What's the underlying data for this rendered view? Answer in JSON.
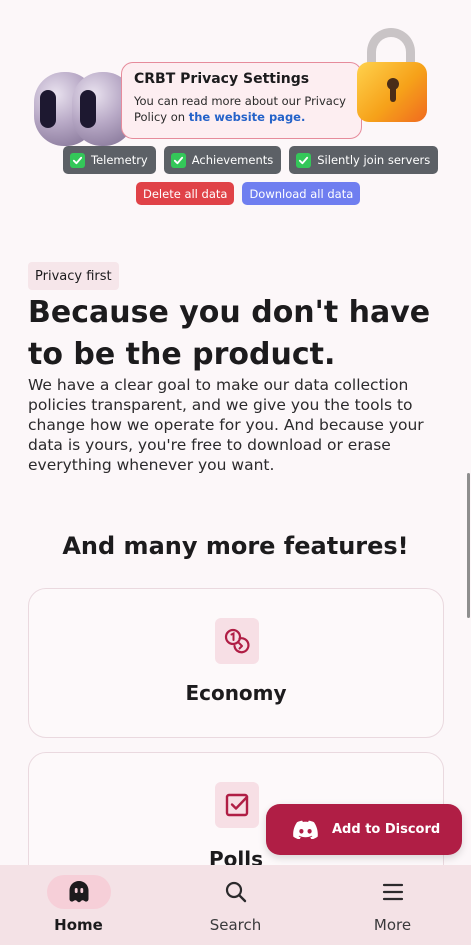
{
  "hero": {
    "card_title": "CRBT Privacy Settings",
    "card_text": "You can read more about our Privacy Policy on",
    "card_link": "the website page.",
    "chips": [
      "Telemetry",
      "Achievements",
      "Silently join servers"
    ],
    "delete_label": "Delete all data",
    "download_label": "Download all data"
  },
  "privacy": {
    "tag": "Privacy first",
    "headline": "Because you don't have to be the product.",
    "paragraph": "We have a clear goal to make our data collection policies transparent, and we give you the tools to change how we operate for you. And because your data is yours, you're free to download or erase everything whenever you want."
  },
  "features": {
    "title": "And many more features!",
    "items": [
      {
        "label": "Economy",
        "icon": "coins-icon"
      },
      {
        "label": "Polls",
        "icon": "checkbox-icon"
      }
    ]
  },
  "discord_button": {
    "label": "Add to Discord",
    "icon": "discord-icon"
  },
  "nav": {
    "items": [
      {
        "label": "Home",
        "icon": "ghost-icon",
        "active": true
      },
      {
        "label": "Search",
        "icon": "search-icon",
        "active": false
      },
      {
        "label": "More",
        "icon": "menu-icon",
        "active": false
      }
    ]
  },
  "colors": {
    "accent": "#b01e45",
    "background": "#fcf7f9",
    "danger": "#e04248",
    "primary": "#6f7ef0",
    "check": "#34c759",
    "nav_bg": "#f4e2e6"
  }
}
